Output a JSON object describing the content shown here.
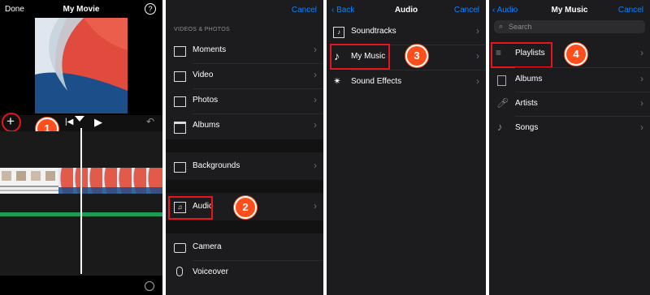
{
  "panel1": {
    "done_label": "Done",
    "title": "My Movie",
    "help_icon_label": "?",
    "callout": "1"
  },
  "panel2": {
    "cancel_label": "Cancel",
    "section_header": "VIDEOS & PHOTOS",
    "items": [
      {
        "label": "Moments"
      },
      {
        "label": "Video"
      },
      {
        "label": "Photos"
      },
      {
        "label": "Albums"
      },
      {
        "label": "Backgrounds"
      },
      {
        "label": "Audio"
      },
      {
        "label": "Camera"
      },
      {
        "label": "Voiceover"
      }
    ],
    "callout": "2"
  },
  "panel3": {
    "back_label": "Back",
    "title": "Audio",
    "cancel_label": "Cancel",
    "items": [
      {
        "label": "Soundtracks"
      },
      {
        "label": "My Music"
      },
      {
        "label": "Sound Effects"
      }
    ],
    "callout": "3"
  },
  "panel4": {
    "back_label": "Audio",
    "title": "My Music",
    "cancel_label": "Cancel",
    "search_placeholder": "Search",
    "items": [
      {
        "label": "Playlists"
      },
      {
        "label": "Albums"
      },
      {
        "label": "Artists"
      },
      {
        "label": "Songs"
      }
    ],
    "callout": "4"
  },
  "colors": {
    "accent": "#0a84ff",
    "highlight": "#e8141e",
    "callout": "#ff4e1b",
    "audio_track": "#1f9d55"
  }
}
